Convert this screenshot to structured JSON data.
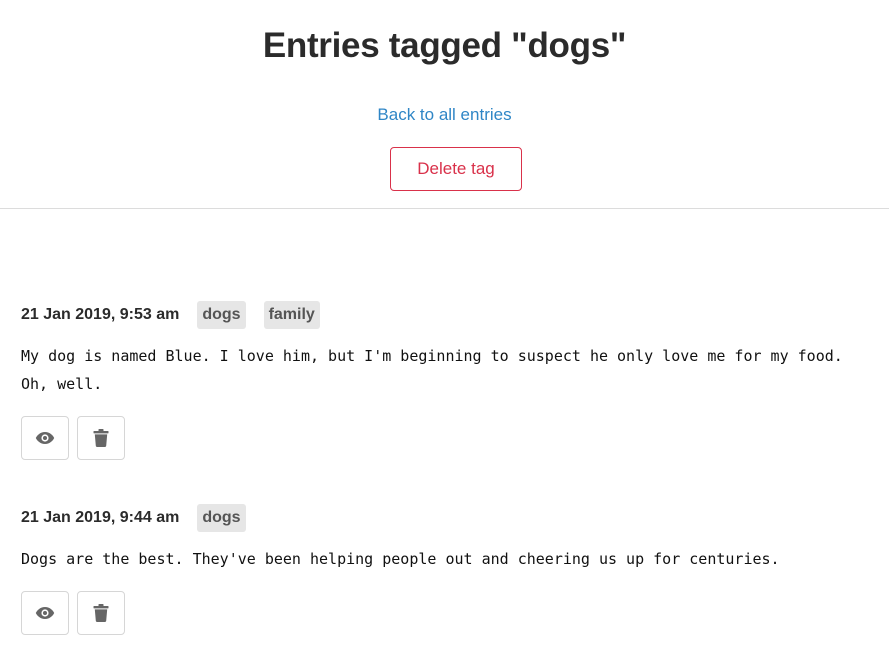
{
  "header": {
    "title": "Entries tagged \"dogs\"",
    "back_link": "Back to all entries",
    "delete_tag": "Delete tag"
  },
  "entries": [
    {
      "date": "21 Jan 2019, 9:53 am",
      "tags": [
        "dogs",
        "family"
      ],
      "text": "My dog is named Blue. I love him, but I'm beginning to suspect he only love me for my food. Oh, well.",
      "actions": [
        {
          "icon": "eye-icon"
        },
        {
          "icon": "trash-icon"
        }
      ]
    },
    {
      "date": "21 Jan 2019, 9:44 am",
      "tags": [
        "dogs"
      ],
      "text": "Dogs are the best. They've been helping people out and cheering us up for centuries.",
      "actions": [
        {
          "icon": "eye-icon"
        },
        {
          "icon": "trash-icon"
        }
      ]
    }
  ],
  "colors": {
    "link": "#2f86c6",
    "danger": "#d9314a",
    "tag_bg": "#e6e6e6",
    "icon": "#666666"
  }
}
